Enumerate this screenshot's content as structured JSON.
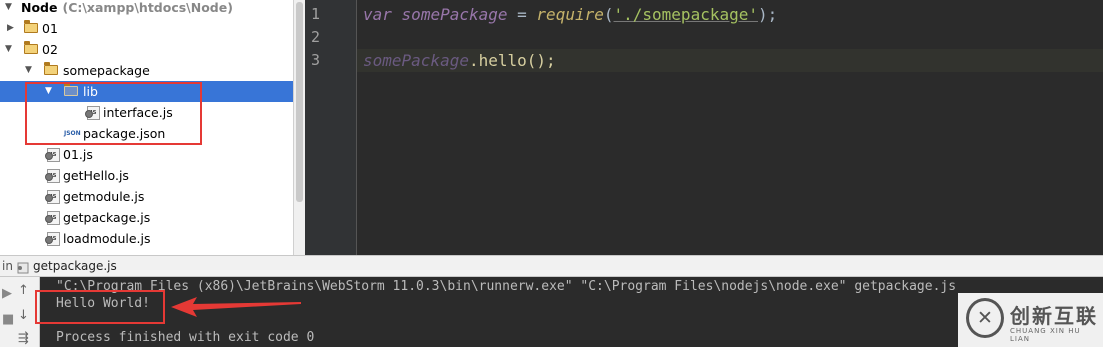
{
  "tree": {
    "root": {
      "label": "Node",
      "path": "(C:\\xampp\\htdocs\\Node)"
    },
    "items": [
      {
        "label": "01"
      },
      {
        "label": "02"
      },
      {
        "label": "somepackage"
      },
      {
        "label": "lib"
      },
      {
        "label": "interface.js"
      },
      {
        "label": "package.json"
      },
      {
        "label": "01.js"
      },
      {
        "label": "getHello.js"
      },
      {
        "label": "getmodule.js"
      },
      {
        "label": "getpackage.js"
      },
      {
        "label": "loadmodule.js"
      }
    ],
    "file_badge": "JS",
    "json_badge": "JSON"
  },
  "editor": {
    "line_numbers": [
      "1",
      "2",
      "3"
    ],
    "line1": {
      "kw": "var",
      "var": "somePackage",
      "eq": " = ",
      "fn": "require",
      "open": "(",
      "str": "'./somepackage'",
      "close": ");"
    },
    "line3": {
      "var": "somePackage",
      "call": ".hello();"
    }
  },
  "run": {
    "prefix": "in",
    "tab_label": "getpackage.js",
    "console_lines": [
      "\"C:\\Program Files (x86)\\JetBrains\\WebStorm 11.0.3\\bin\\runnerw.exe\" \"C:\\Program Files\\nodejs\\node.exe\" getpackage.js",
      "Hello World!",
      "",
      "Process finished with exit code 0"
    ]
  },
  "watermark": {
    "title": "创新互联",
    "subtitle": "CHUANG XIN HU LIAN"
  },
  "colors": {
    "selection": "#3875d7",
    "annotation_red": "#e53935",
    "keyword": "#9876aa",
    "string": "#a5c261"
  }
}
